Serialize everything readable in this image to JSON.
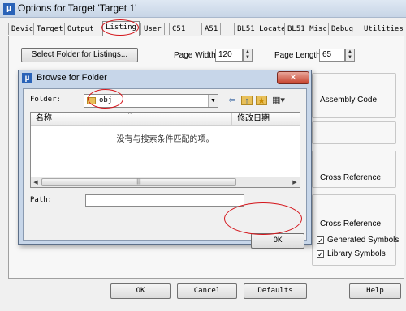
{
  "main_window": {
    "title": "Options for Target 'Target 1'",
    "icon_glyph": "µ",
    "tabs": [
      "Device",
      "Target",
      "Output",
      "Listing",
      "User",
      "C51",
      "A51",
      "BL51 Locate",
      "BL51 Misc",
      "Debug",
      "Utilities"
    ],
    "active_tab": "Listing",
    "select_folder_button": "Select Folder for Listings...",
    "page_width_label": "Page Width:",
    "page_width_value": "120",
    "page_length_label": "Page Length:",
    "page_length_value": "65",
    "assembly_code_label": "Assembly Code",
    "cross_reference_label_1": "Cross Reference",
    "cross_reference_label_2": "Cross Reference",
    "generated_symbols_label": "Generated Symbols",
    "library_symbols_label": "Library Symbols",
    "check_glyph": "✓",
    "ok_button": "OK",
    "cancel_button": "Cancel",
    "defaults_button": "Defaults",
    "help_button": "Help"
  },
  "browse_dialog": {
    "title": "Browse for Folder",
    "icon_glyph": "µ",
    "close_glyph": "✕",
    "folder_label": "Folder:",
    "folder_value": "obj",
    "toolbar_icons": [
      "back-arrow-icon",
      "up-folder-icon",
      "new-folder-icon",
      "view-menu-icon"
    ],
    "toolbar_glyphs": [
      "⇦",
      "↑",
      "★",
      "▦▾"
    ],
    "columns": [
      "名称",
      "修改日期"
    ],
    "sort_glyph": "^",
    "empty_message": "没有与搜索条件匹配的项。",
    "path_label": "Path:",
    "path_value": "",
    "ok_button": "OK"
  },
  "annotations": {
    "highlight_color": "#d4151b"
  }
}
